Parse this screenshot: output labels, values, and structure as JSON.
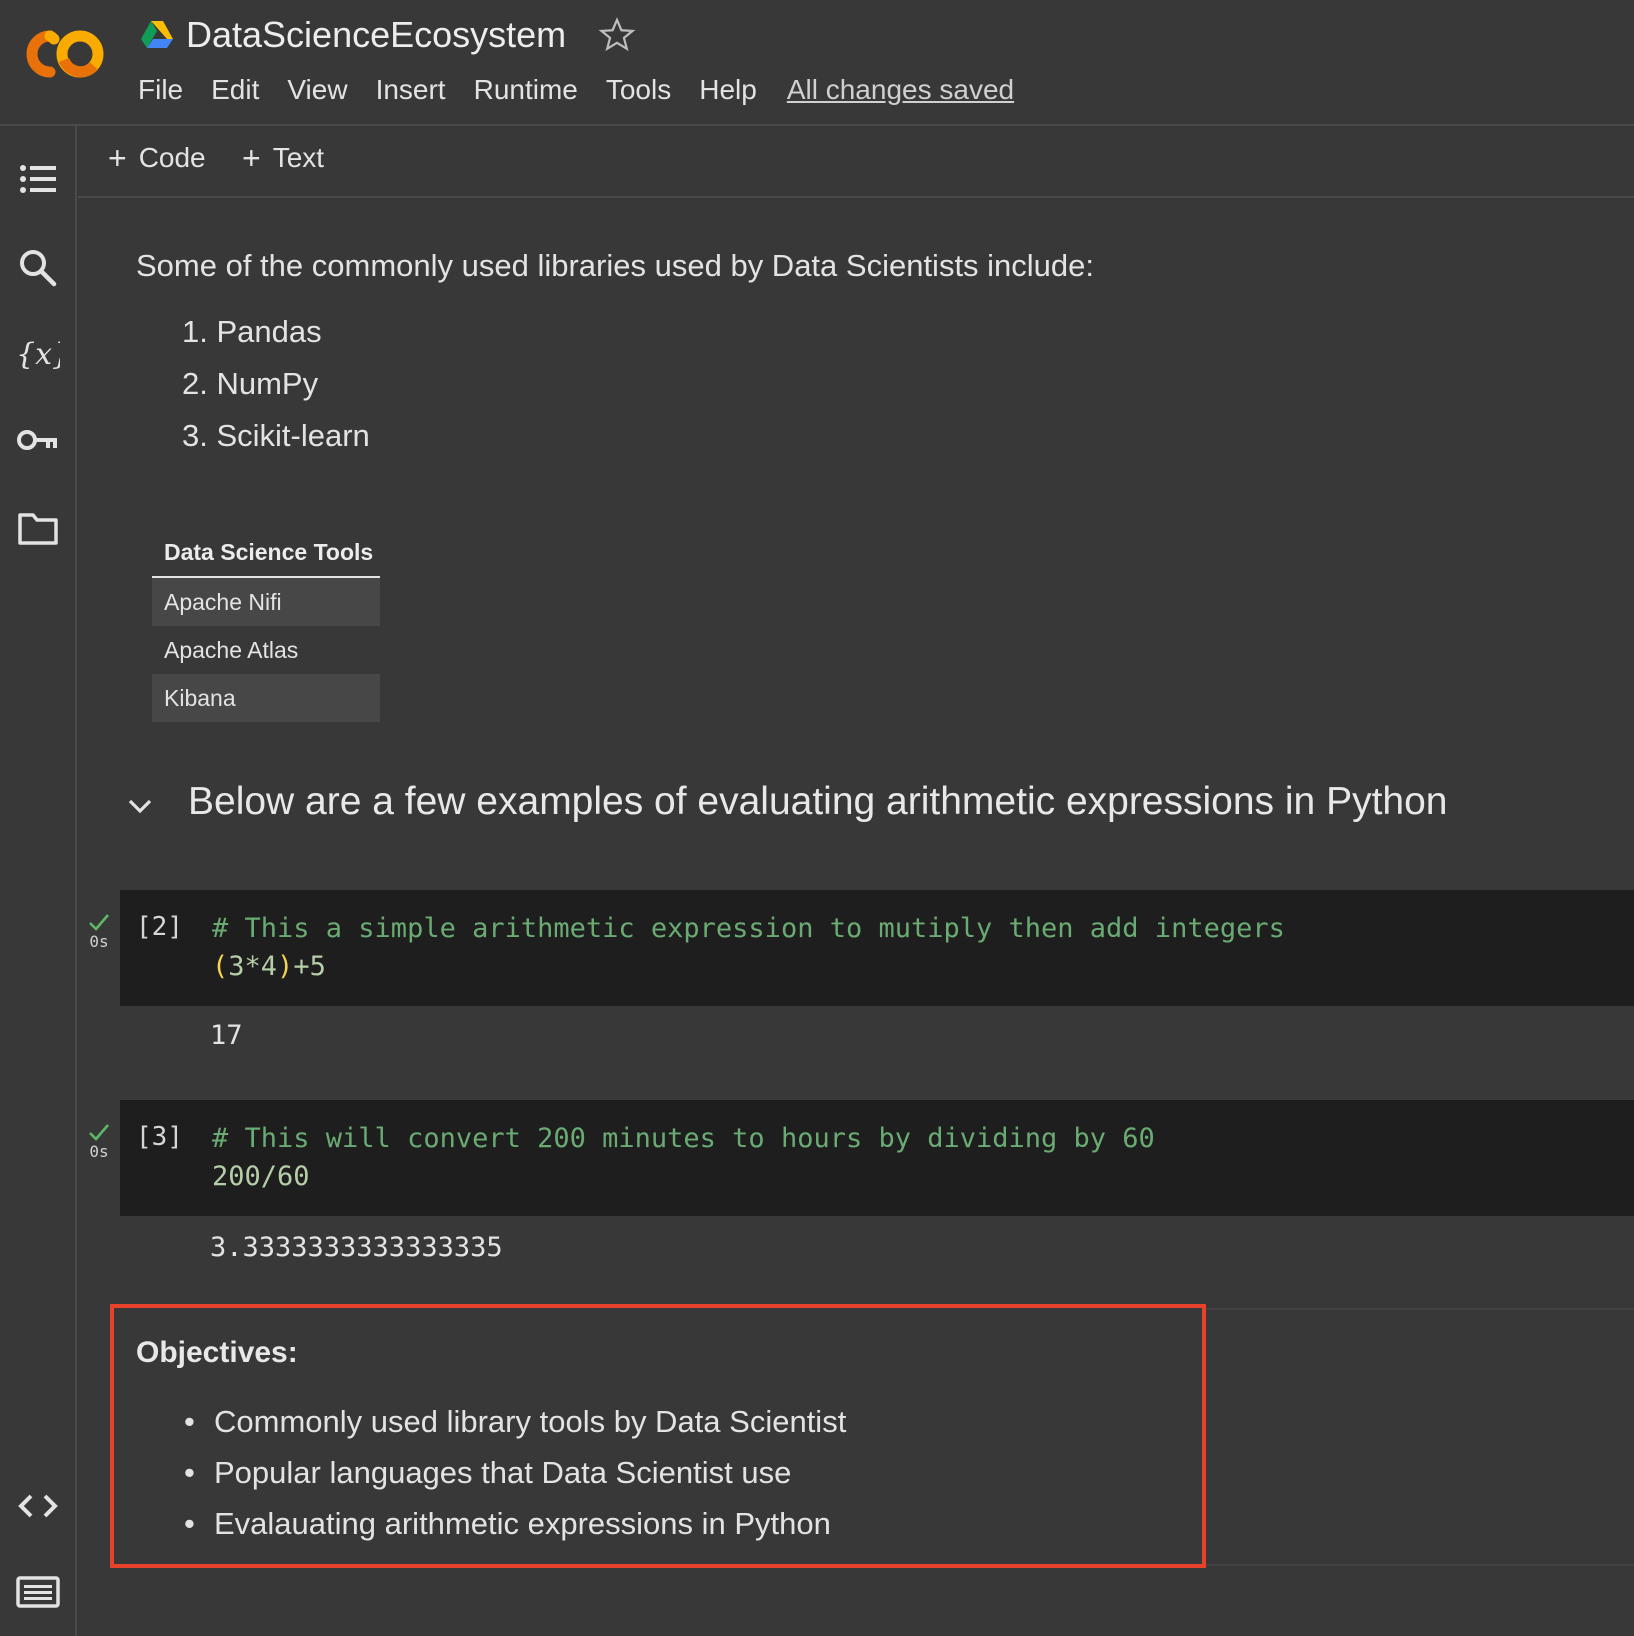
{
  "header": {
    "title": "DataScienceEcosystem",
    "menu": [
      "File",
      "Edit",
      "View",
      "Insert",
      "Runtime",
      "Tools",
      "Help"
    ],
    "save_status": "All changes saved"
  },
  "sidebar": {
    "icons": [
      "table-of-contents-icon",
      "search-icon",
      "variables-icon",
      "secrets-key-icon",
      "files-folder-icon",
      "code-snippets-icon",
      "terminal-icon"
    ]
  },
  "toolbar": {
    "add_code": "Code",
    "add_text": "Text"
  },
  "notebook": {
    "intro": "Some of the commonly used libraries used by Data Scientists include:",
    "libraries": [
      "1. Pandas",
      "2. NumPy",
      "3. Scikit-learn"
    ],
    "tools_table": {
      "header": "Data Science Tools",
      "rows": [
        "Apache Nifi",
        "Apache Atlas",
        "Kibana"
      ]
    },
    "section_heading": "Below are a few examples of evaluating arithmetic expressions in Python",
    "cells": [
      {
        "exec_count": "[2]",
        "time": "0s",
        "comment": "# This a simple arithmetic expression to mutiply then add integers",
        "code_open": "(",
        "code_mid": "3*4",
        "code_close": ")",
        "code_tail": "+5",
        "output": "17"
      },
      {
        "exec_count": "[3]",
        "time": "0s",
        "comment": "# This will convert 200 minutes to hours by dividing by 60",
        "code": "200/60",
        "output": "3.3333333333333335"
      }
    ],
    "objectives": {
      "title": "Objectives:",
      "items": [
        "Commonly used library tools by Data Scientist",
        "Popular languages that Data Scientist use",
        "Evalauating arithmetic expressions in Python"
      ]
    }
  },
  "colors": {
    "background": "#383838",
    "code_bg": "#1e1e1e",
    "comment": "#6aab73",
    "highlight_box": "#e8412c",
    "logo_orange": "#f9ab00",
    "logo_dark_orange": "#e8710a"
  }
}
